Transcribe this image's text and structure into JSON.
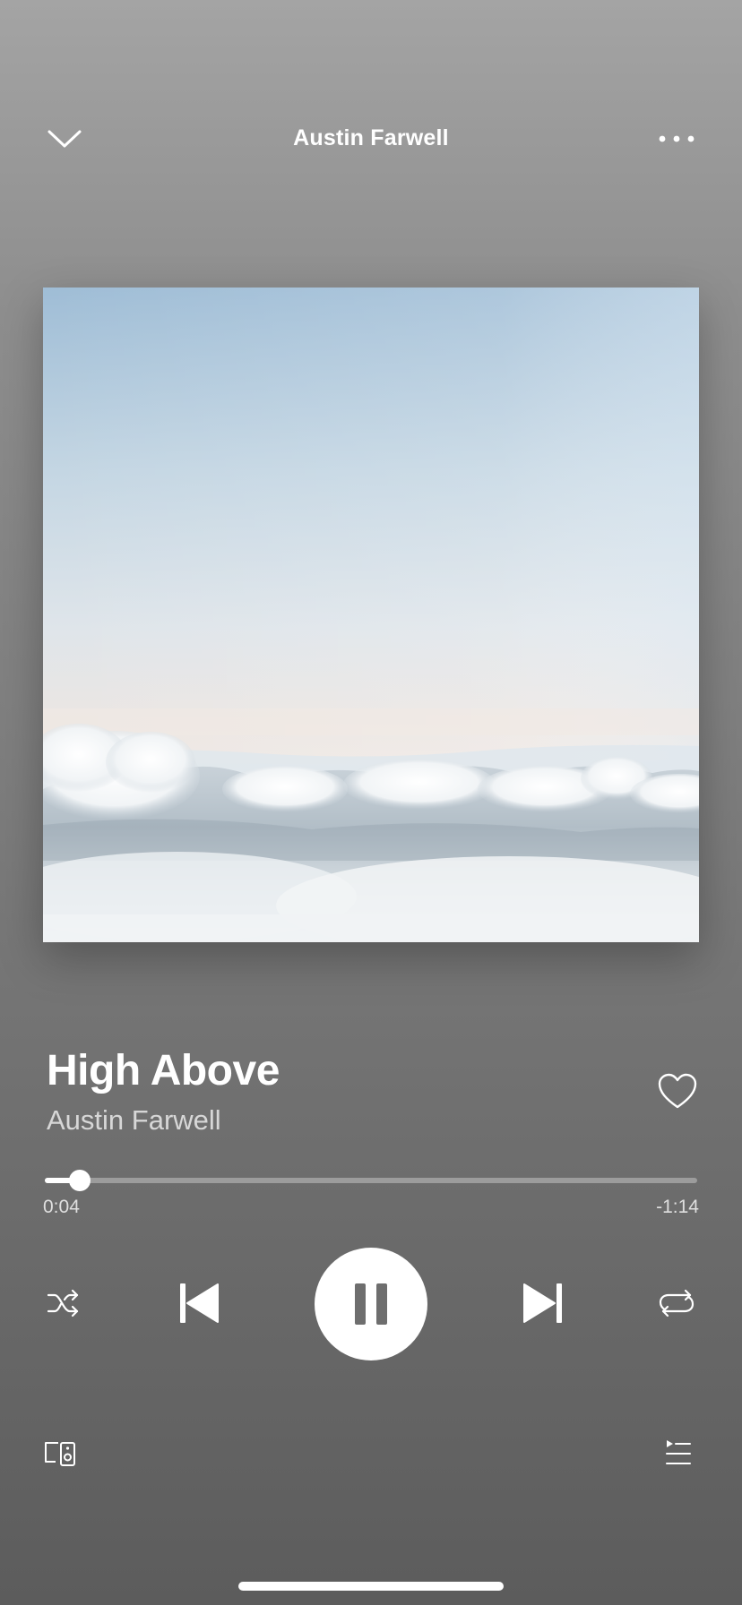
{
  "header": {
    "title": "Austin Farwell"
  },
  "track": {
    "title": "High Above",
    "artist": "Austin Farwell"
  },
  "playback": {
    "elapsed": "0:04",
    "remaining": "-1:14",
    "progress_fraction": 0.054,
    "state": "playing"
  },
  "icons": {
    "collapse": "chevron-down-icon",
    "more": "more-dots-icon",
    "like": "heart-icon",
    "shuffle": "shuffle-icon",
    "previous": "skip-previous-icon",
    "pause": "pause-icon",
    "next": "skip-next-icon",
    "repeat": "repeat-icon",
    "devices": "devices-icon",
    "queue": "queue-icon"
  },
  "colors": {
    "background_top": "#a4a4a4",
    "background_bottom": "#5c5c5c",
    "foreground": "#ffffff"
  }
}
